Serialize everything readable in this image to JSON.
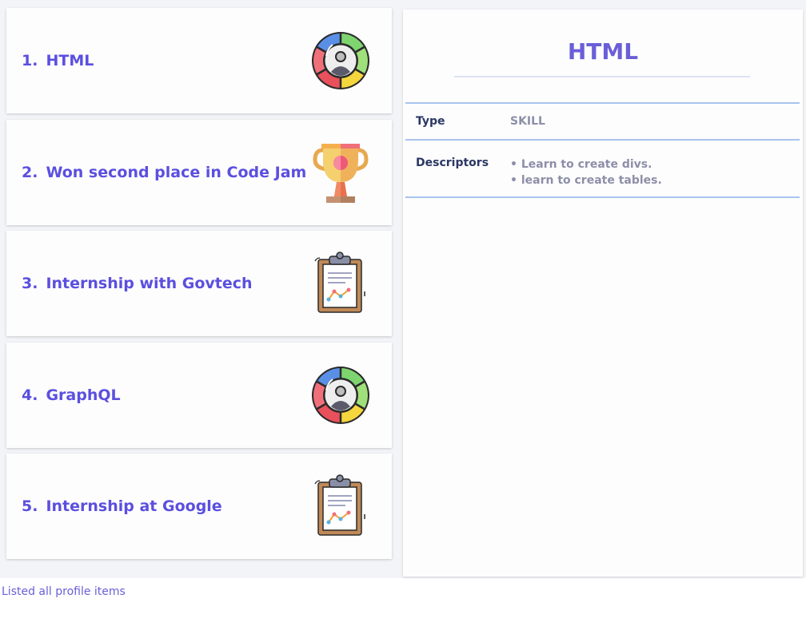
{
  "profile_items": [
    {
      "index": "1.",
      "title": "HTML",
      "icon": "skill-wheel-icon"
    },
    {
      "index": "2.",
      "title": "Won second place in Code Jam",
      "icon": "trophy-icon"
    },
    {
      "index": "3.",
      "title": "Internship with Govtech",
      "icon": "clipboard-chart-icon"
    },
    {
      "index": "4.",
      "title": "GraphQL",
      "icon": "skill-wheel-icon"
    },
    {
      "index": "5.",
      "title": "Internship at Google",
      "icon": "clipboard-chart-icon"
    }
  ],
  "detail": {
    "title": "HTML",
    "type_label": "Type",
    "type_value": "SKILL",
    "descriptors_label": "Descriptors",
    "descriptors": [
      "Learn to create divs.",
      "learn to create tables."
    ]
  },
  "status_message": "Listed all profile items",
  "colors": {
    "accent": "#5b4fe0",
    "divider": "#a8c3ef",
    "background": "#f3f4f7"
  }
}
